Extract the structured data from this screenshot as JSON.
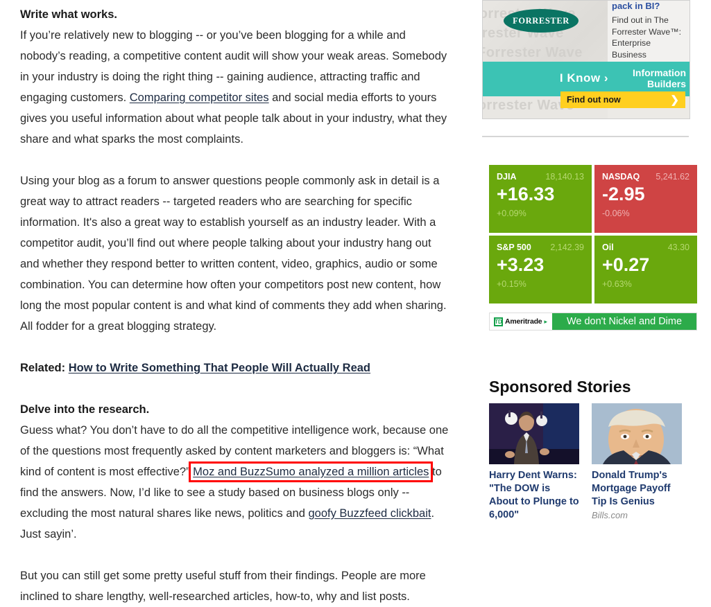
{
  "article": {
    "heading1": "Write what works.",
    "para1_a": "If you’re relatively new to blogging -- or you’ve been blogging for a while and nobody’s reading, a competitive content audit will show your weak areas. Somebody in your industry is doing the right thing -- gaining audience, attracting traffic and engaging customers. ",
    "para1_link": "Comparing competitor sites",
    "para1_b": " and social media efforts to yours gives you useful information about what people talk about in your industry, what they share and what sparks the most complaints.",
    "para2": "Using your blog as a forum to answer questions people commonly ask in detail is a great way to attract readers -- targeted readers who are searching for specific information. It's also a great way to establish yourself as an industry leader. With a competitor audit, you’ll find out where people talking about your industry hang out and whether they respond better to written content, video, graphics, audio or some combination. You can determine how often your competitors post new content, how long the most popular content is and what kind of comments they add when sharing. All fodder for a great blogging strategy.",
    "related_label": "Related:",
    "related_link": "How to Write Something That People Will Actually Read",
    "heading2": "Delve into the research.",
    "para3_a": "Guess what? You don’t have to do all the competitive intelligence work, because one of the questions most frequently asked by content marketers and bloggers is: “What kind of content is most effective?” ",
    "para3_link_hl": "Moz and BuzzSumo analyzed a million articles",
    "para3_b": " to find the answers. Now, I’d like to see a study based on business blogs only -- excluding the most natural shares like news, politics and ",
    "para3_link2": "goofy Buzzfeed clickbait",
    "para3_c": ". Just sayin’.",
    "para4": "But you can still get some pretty useful stuff from their findings. People are more inclined to share lengthy, well-researched articles, how-to, why and list posts."
  },
  "ad": {
    "kicker": "pack in BI?",
    "body": "Find out in The Forrester Wave™: Enterprise Business Intelligence Platforms.",
    "brand_logo": "FORRESTER",
    "watermark": "Forrester Wave",
    "i_know": "I Know ›",
    "advertiser_line1": "Information",
    "advertiser_line2": "Builders",
    "cta_label": "Find out now",
    "cta_arrow": "❯"
  },
  "ticker": {
    "quotes": [
      {
        "symbol": "DJIA",
        "last": "18,140.13",
        "change": "+16.33",
        "percent": "+0.09%",
        "direction": "up"
      },
      {
        "symbol": "NASDAQ",
        "last": "5,241.62",
        "change": "-2.95",
        "percent": "-0.06%",
        "direction": "down"
      },
      {
        "symbol": "S&P 500",
        "last": "2,142.39",
        "change": "+3.23",
        "percent": "+0.15%",
        "direction": "up"
      },
      {
        "symbol": "Oil",
        "last": "43.30",
        "change": "+0.27",
        "percent": "+0.63%",
        "direction": "up"
      }
    ]
  },
  "td_banner": {
    "mark": "TD",
    "brand": "Ameritrade",
    "caret": "▸",
    "message": "We don't Nickel and Dime"
  },
  "sponsored": {
    "title": "Sponsored Stories",
    "stories": [
      {
        "title": "Harry Dent Warns: \"The DOW is About to Plunge to 6,000\"",
        "source": ""
      },
      {
        "title": "Donald Trump's Mortgage Payoff Tip Is Genius",
        "source": "Bills.com"
      }
    ]
  },
  "colors": {
    "up": "#6aa80d",
    "down": "#cf4444",
    "highlight": "#ff0000",
    "teal": "#3cc3b4",
    "cta_yellow": "#ffcf20",
    "td_green": "#2cab4a",
    "story_link": "#1f3a6e"
  }
}
